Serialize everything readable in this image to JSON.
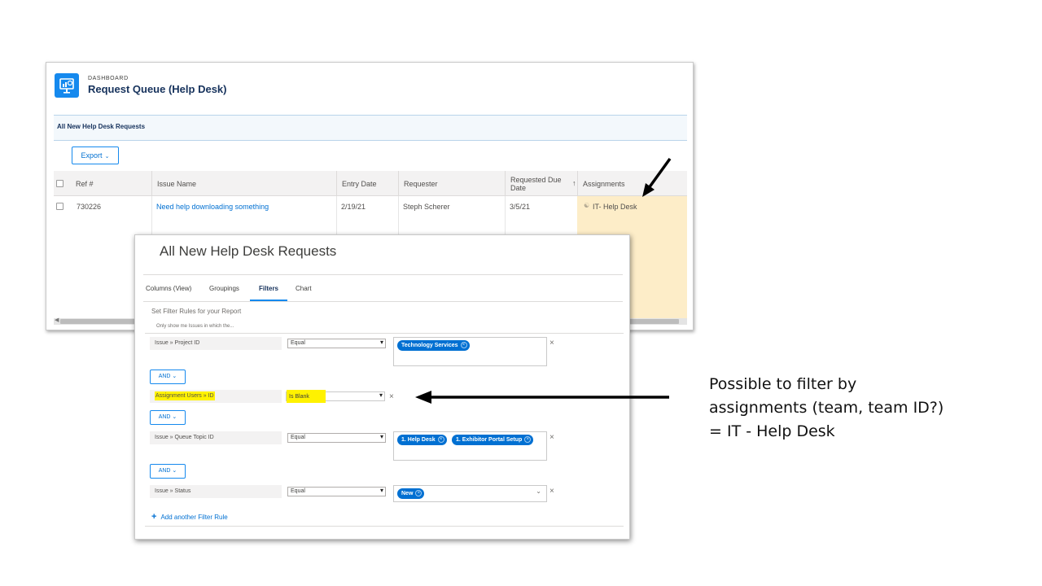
{
  "dashboard": {
    "kicker": "DASHBOARD",
    "title": "Request Queue (Help Desk)",
    "report_name": "All New Help Desk Requests",
    "export_label": "Export",
    "columns": [
      "Ref #",
      "Issue Name",
      "Entry Date",
      "Requester",
      "Requested Due Date",
      "Assignments"
    ],
    "rows": [
      {
        "ref": "730226",
        "issue": "Need help downloading something",
        "entry_date": "2/19/21",
        "requester": "Steph Scherer",
        "due": "3/5/21",
        "assignment": "IT- Help Desk"
      }
    ],
    "highlight_color": "#fdedc8"
  },
  "modal": {
    "title": "All New Help Desk Requests",
    "tabs": [
      "Columns (View)",
      "Groupings",
      "Filters",
      "Chart"
    ],
    "active_tab": "Filters",
    "section_label": "Set Filter Rules for your Report",
    "subtitle": "Only show me Issues in which the...",
    "rules": [
      {
        "field_a": "Issue",
        "field_b": "Project ID",
        "operator": "Equal",
        "values": [
          "Technology Services"
        ]
      },
      {
        "field_a": "Assignment Users",
        "field_b": "ID",
        "operator": "Is Blank",
        "values": []
      },
      {
        "field_a": "Issue",
        "field_b": "Queue Topic ID",
        "operator": "Equal",
        "values": [
          "1. Help Desk",
          "1. Exhibitor Portal Setup"
        ]
      },
      {
        "field_a": "Issue",
        "field_b": "Status",
        "operator": "Equal",
        "values": [
          "New"
        ]
      }
    ],
    "and_label": "AND",
    "add_rule_label": "Add another Filter Rule",
    "highlight_color": "#fff200"
  },
  "annotation": {
    "text": "Possible to filter by assignments (team, team ID?) = IT - Help Desk"
  },
  "colors": {
    "accent": "#0070d2",
    "chip": "#0070d2",
    "brand_icon": "#1589ee"
  }
}
